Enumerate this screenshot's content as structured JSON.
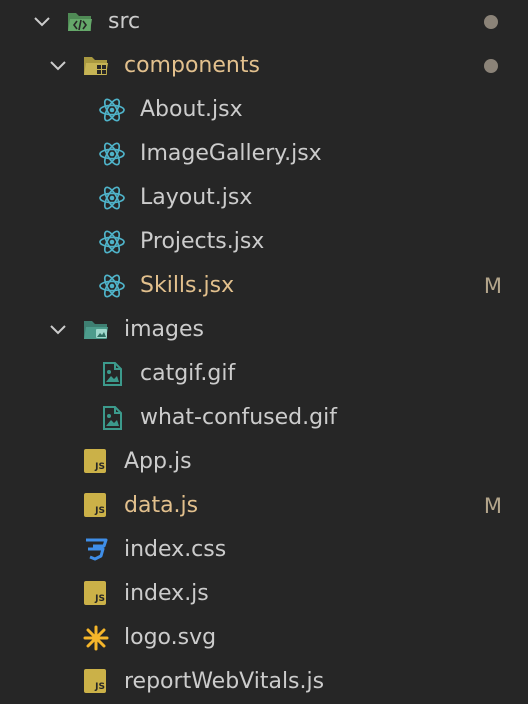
{
  "tree": {
    "src": {
      "label": "src",
      "icon": "folder-src-open-icon",
      "decoration": "dot"
    },
    "components": {
      "label": "components",
      "icon": "folder-components-open-icon",
      "decoration": "dot"
    },
    "component_files": [
      {
        "label": "About.jsx",
        "icon": "react-icon"
      },
      {
        "label": "ImageGallery.jsx",
        "icon": "react-icon"
      },
      {
        "label": "Layout.jsx",
        "icon": "react-icon"
      },
      {
        "label": "Projects.jsx",
        "icon": "react-icon"
      },
      {
        "label": "Skills.jsx",
        "icon": "react-icon",
        "badge": "M"
      }
    ],
    "images": {
      "label": "images",
      "icon": "folder-images-open-icon"
    },
    "image_files": [
      {
        "label": "catgif.gif",
        "icon": "image-file-icon"
      },
      {
        "label": "what-confused.gif",
        "icon": "image-file-icon"
      }
    ],
    "src_files": [
      {
        "label": "App.js",
        "icon": "js-file-icon",
        "icon_text": "JS"
      },
      {
        "label": "data.js",
        "icon": "js-file-icon",
        "icon_text": "JS",
        "badge": "M"
      },
      {
        "label": "index.css",
        "icon": "css-file-icon"
      },
      {
        "label": "index.js",
        "icon": "js-file-icon",
        "icon_text": "JS"
      },
      {
        "label": "logo.svg",
        "icon": "svg-file-icon"
      },
      {
        "label": "reportWebVitals.js",
        "icon": "js-file-icon",
        "icon_text": "JS"
      }
    ]
  },
  "colors": {
    "background": "#262626",
    "text": "#cccccc",
    "modified_text": "#e2c08d",
    "badge": "#b3a58b",
    "react": "#4fb3c9",
    "js": "#cbb148",
    "css": "#3f8ee8",
    "svg": "#f5b52a",
    "folder_src": "#65a86a",
    "folder_components": "#c6b455",
    "folder_images": "#4d9c8c",
    "image_file": "#3c9a8c"
  }
}
